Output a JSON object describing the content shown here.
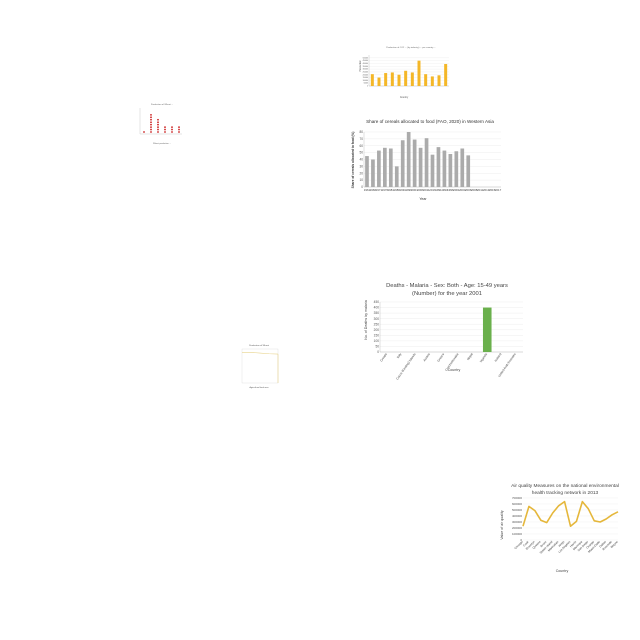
{
  "chart_data": [
    {
      "type": "bar",
      "title": "Production of CO2 ... (by industry) ... per country ...",
      "xlabel": "Country",
      "ylabel": "Production",
      "ylim": [
        0,
        550000
      ],
      "yticks": [
        0,
        50000,
        100000,
        150000,
        200000,
        250000,
        300000,
        350000,
        400000,
        450000,
        500000
      ],
      "categories": [
        "",
        "",
        "",
        "",
        "",
        "",
        "",
        "",
        "",
        "",
        "",
        ""
      ],
      "values": [
        210000,
        150000,
        230000,
        240000,
        200000,
        270000,
        240000,
        450000,
        210000,
        170000,
        190000,
        390000
      ],
      "color": "#f4b728",
      "grid": true
    },
    {
      "type": "bar",
      "title": "Share of cereals allocated to food (FAO, 2020) in Western Asia",
      "xlabel": "Year",
      "ylabel": "Share of cereals allocated to food (%)",
      "ylim": [
        0,
        80
      ],
      "yticks": [
        0,
        10,
        20,
        30,
        40,
        50,
        60,
        70,
        80
      ],
      "categories": [
        "1961",
        "1966",
        "1971",
        "1976",
        "1981",
        "1986",
        "1991",
        "1996",
        "2001",
        "2006",
        "2011",
        "2016",
        "1991",
        "1993",
        "1996",
        "2001",
        "2004",
        "2006",
        "2008",
        "2011",
        "2013",
        "2015",
        "2017"
      ],
      "values": [
        45,
        40,
        53,
        57,
        56,
        30,
        68,
        80,
        69,
        57,
        71,
        47,
        58,
        53,
        48,
        52,
        56,
        46,
        0,
        0,
        0,
        0,
        0
      ],
      "color": "#ababab",
      "grid": true
    },
    {
      "type": "bar",
      "title": "Deaths - Malaria - Sex: Both - Age: 15-49 years (Number) for the year 2001",
      "xlabel": "Country",
      "ylabel": "No. of Deaths by malaria",
      "ylim": [
        0,
        450
      ],
      "yticks": [
        0,
        50,
        100,
        150,
        200,
        250,
        300,
        350,
        400,
        450
      ],
      "categories": [
        "Croatia",
        "Italy",
        "Cocos (Keeling) Islands",
        "Austria",
        "Greece",
        "Czechoslovakia",
        "Nepal",
        "Uganda",
        "Iceland",
        "United Arab Emirates"
      ],
      "values": [
        0,
        0,
        0,
        0,
        0,
        0,
        0,
        400,
        0,
        0
      ],
      "color": "#6ab04c",
      "grid": true
    },
    {
      "type": "line",
      "title": "Air quality Measures on the national environmental health tracking network in 2013",
      "xlabel": "Country",
      "ylabel": "Value of air quality",
      "ylim": [
        0,
        700000
      ],
      "yticks": [
        0,
        100000,
        200000,
        300000,
        400000,
        500000,
        600000,
        700000
      ],
      "categories": [
        "Chicago",
        "Cook",
        "Brooklyn",
        "Queens",
        "Bronx",
        "Staten Island",
        "Manhattan",
        "Kings",
        "Los Angeles",
        "Harris",
        "Maricopa",
        "San Diego",
        "Orange",
        "Miami-Dade",
        "Dallas",
        "Riverside",
        "Wayne"
      ],
      "values": [
        230000,
        560000,
        490000,
        330000,
        290000,
        450000,
        570000,
        640000,
        230000,
        310000,
        640000,
        520000,
        320000,
        300000,
        350000,
        420000,
        470000
      ],
      "color": "#e5b73b",
      "grid": true
    },
    {
      "type": "scatter",
      "title": "Production of Wheat ...",
      "xlabel": "Wheat production ...",
      "ylabel": "",
      "points": [
        [
          0,
          1
        ],
        [
          1,
          8
        ],
        [
          2,
          6
        ],
        [
          3,
          3
        ],
        [
          4,
          3
        ],
        [
          5,
          3
        ]
      ],
      "color": "#cc2222",
      "grid": true
    },
    {
      "type": "line",
      "title": "Production of Wheat",
      "xlabel": "Agricultural land area",
      "ylabel": "",
      "values": [
        0.9,
        0.9,
        0.88,
        0.86,
        0.85
      ],
      "color": "#e8d38a",
      "grid": true
    }
  ]
}
